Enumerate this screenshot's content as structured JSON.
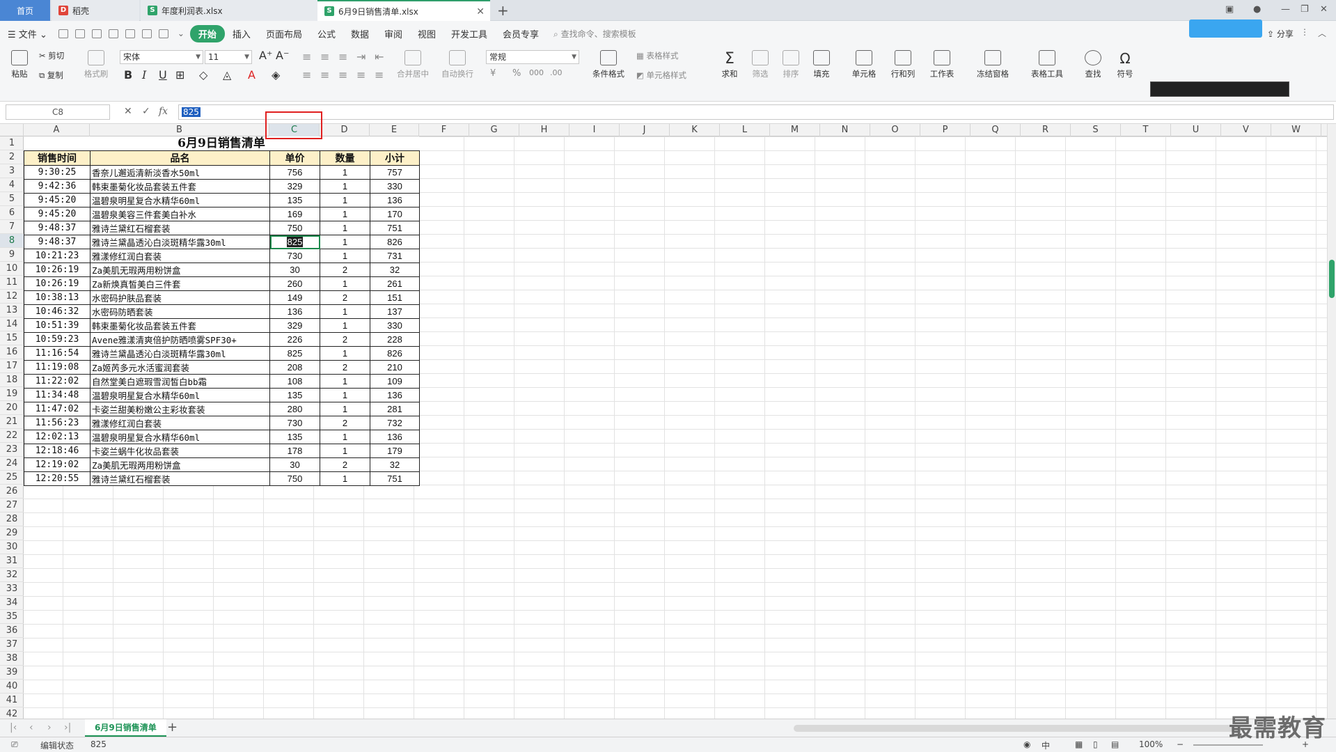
{
  "tabs": {
    "home": "首页",
    "daoke": "稻壳",
    "profit": "年度利润表.xlsx",
    "sales": "6月9日销售清单.xlsx"
  },
  "menu": [
    "文件",
    "开始",
    "插入",
    "页面布局",
    "公式",
    "数据",
    "审阅",
    "视图",
    "开发工具",
    "会员专享"
  ],
  "menu_search_placeholder": "查找命令、搜索模板",
  "share_label": "分享",
  "ribbon": {
    "paste": "粘贴",
    "cut": "剪切",
    "copy": "复制",
    "format_painter": "格式刷",
    "font_name": "宋体",
    "font_size": "11",
    "number_format": "常规",
    "merge": "合并居中",
    "wrap": "自动换行",
    "cond_format": "条件格式",
    "table_style": "表格样式",
    "cell_style": "单元格样式",
    "sum": "求和",
    "filter": "筛选",
    "sort": "排序",
    "fill": "填充",
    "cell": "单元格",
    "rowcol": "行和列",
    "worksheet": "工作表",
    "freeze": "冻结窗格",
    "table_tools": "表格工具",
    "find": "查找",
    "symbol": "符号",
    "bold": "B",
    "italic": "I",
    "underline": "U"
  },
  "formula_bar": {
    "name_box": "C8",
    "value": "825"
  },
  "columns": [
    "A",
    "B",
    "C",
    "D",
    "E",
    "F",
    "G",
    "H",
    "I",
    "J",
    "K",
    "L",
    "M",
    "N",
    "O",
    "P",
    "Q",
    "R",
    "S",
    "T",
    "U",
    "V",
    "W"
  ],
  "row_count": 43,
  "sheet": {
    "title": "6月9日销售清单",
    "headers": [
      "销售时间",
      "品名",
      "单价",
      "数量",
      "小计"
    ],
    "rows": [
      [
        "9:30:25",
        "香奈儿邂逅清新淡香水50ml",
        "756",
        "1",
        "757"
      ],
      [
        "9:42:36",
        "韩束墨菊化妆品套装五件套",
        "329",
        "1",
        "330"
      ],
      [
        "9:45:20",
        "温碧泉明星复合水精华60ml",
        "135",
        "1",
        "136"
      ],
      [
        "9:45:20",
        "温碧泉美容三件套美白补水",
        "169",
        "1",
        "170"
      ],
      [
        "9:48:37",
        "雅诗兰黛红石榴套装",
        "750",
        "1",
        "751"
      ],
      [
        "9:48:37",
        "雅诗兰黛晶透沁白淡斑精华露30ml",
        "825",
        "1",
        "826"
      ],
      [
        "10:21:23",
        "雅漾修红润白套装",
        "730",
        "1",
        "731"
      ],
      [
        "10:26:19",
        "Za美肌无瑕两用粉饼盒",
        "30",
        "2",
        "32"
      ],
      [
        "10:26:19",
        "Za新焕真皙美白三件套",
        "260",
        "1",
        "261"
      ],
      [
        "10:38:13",
        "水密码护肤品套装",
        "149",
        "2",
        "151"
      ],
      [
        "10:46:32",
        "水密码防晒套装",
        "136",
        "1",
        "137"
      ],
      [
        "10:51:39",
        "韩束墨菊化妆品套装五件套",
        "329",
        "1",
        "330"
      ],
      [
        "10:59:23",
        "Avene雅漾清爽倍护防晒喷雾SPF30+",
        "226",
        "2",
        "228"
      ],
      [
        "11:16:54",
        "雅诗兰黛晶透沁白淡斑精华露30ml",
        "825",
        "1",
        "826"
      ],
      [
        "11:19:08",
        "Za姬芮多元水活蜜润套装",
        "208",
        "2",
        "210"
      ],
      [
        "11:22:02",
        "自然堂美白遮瑕雪润皙白bb霜",
        "108",
        "1",
        "109"
      ],
      [
        "11:34:48",
        "温碧泉明星复合水精华60ml",
        "135",
        "1",
        "136"
      ],
      [
        "11:47:02",
        "卡姿兰甜美粉嫩公主彩妆套装",
        "280",
        "1",
        "281"
      ],
      [
        "11:56:23",
        "雅漾修红润白套装",
        "730",
        "2",
        "732"
      ],
      [
        "12:02:13",
        "温碧泉明星复合水精华60ml",
        "135",
        "1",
        "136"
      ],
      [
        "12:18:46",
        "卡姿兰蜗牛化妆品套装",
        "178",
        "1",
        "179"
      ],
      [
        "12:19:02",
        "Za美肌无瑕两用粉饼盒",
        "30",
        "2",
        "32"
      ],
      [
        "12:20:55",
        "雅诗兰黛红石榴套装",
        "750",
        "1",
        "751"
      ]
    ]
  },
  "sheet_tab": "6月9日销售清单",
  "status": {
    "mode": "编辑状态",
    "value": "825",
    "zoom": "100%"
  },
  "watermark": "最需教育",
  "colors": {
    "accent": "#2fa36a",
    "header_fill": "#fdf0c8",
    "highlight": "#e02020"
  }
}
